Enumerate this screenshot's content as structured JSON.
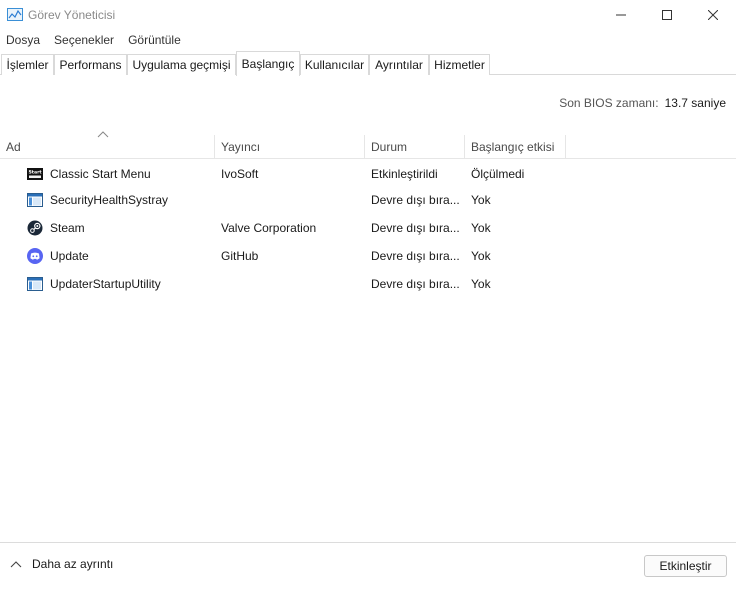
{
  "window": {
    "title": "Görev Yöneticisi",
    "controls": {
      "minimize_icon": "minimize-icon",
      "maximize_icon": "maximize-icon",
      "close_icon": "close-icon"
    }
  },
  "menu": [
    "Dosya",
    "Seçenekler",
    "Görüntüle"
  ],
  "tabs": [
    {
      "label": "İşlemler",
      "active": false
    },
    {
      "label": "Performans",
      "active": false
    },
    {
      "label": "Uygulama geçmişi",
      "active": false
    },
    {
      "label": "Başlangıç",
      "active": true
    },
    {
      "label": "Kullanıcılar",
      "active": false
    },
    {
      "label": "Ayrıntılar",
      "active": false
    },
    {
      "label": "Hizmetler",
      "active": false
    }
  ],
  "bios": {
    "label": "Son BIOS zamanı:",
    "value": "13.7 saniye"
  },
  "table": {
    "sorted_by": "Ad",
    "sort_direction": "ascending",
    "columns": [
      "Ad",
      "Yayıncı",
      "Durum",
      "Başlangıç etkisi"
    ],
    "rows": [
      {
        "icon": "classic-start-menu-icon",
        "name": "Classic Start Menu",
        "publisher": "IvoSoft",
        "status": "Etkinleştirildi",
        "impact": "Ölçülmedi"
      },
      {
        "icon": "security-health-icon",
        "name": "SecurityHealthSystray",
        "publisher": "",
        "status": "Devre dışı bıra...",
        "impact": "Yok"
      },
      {
        "icon": "steam-icon",
        "name": "Steam",
        "publisher": "Valve Corporation",
        "status": "Devre dışı bıra...",
        "impact": "Yok"
      },
      {
        "icon": "discord-icon",
        "name": "Update",
        "publisher": "GitHub",
        "status": "Devre dışı bıra...",
        "impact": "Yok"
      },
      {
        "icon": "updater-utility-icon",
        "name": "UpdaterStartupUtility",
        "publisher": "",
        "status": "Devre dışı bıra...",
        "impact": "Yok"
      }
    ]
  },
  "footer": {
    "less_detail_label": "Daha az ayrıntı",
    "enable_button_label": "Etkinleştir"
  },
  "colors": {
    "discord": "#5865f2",
    "steam": "#1b2838",
    "accent": "#0067c0"
  }
}
